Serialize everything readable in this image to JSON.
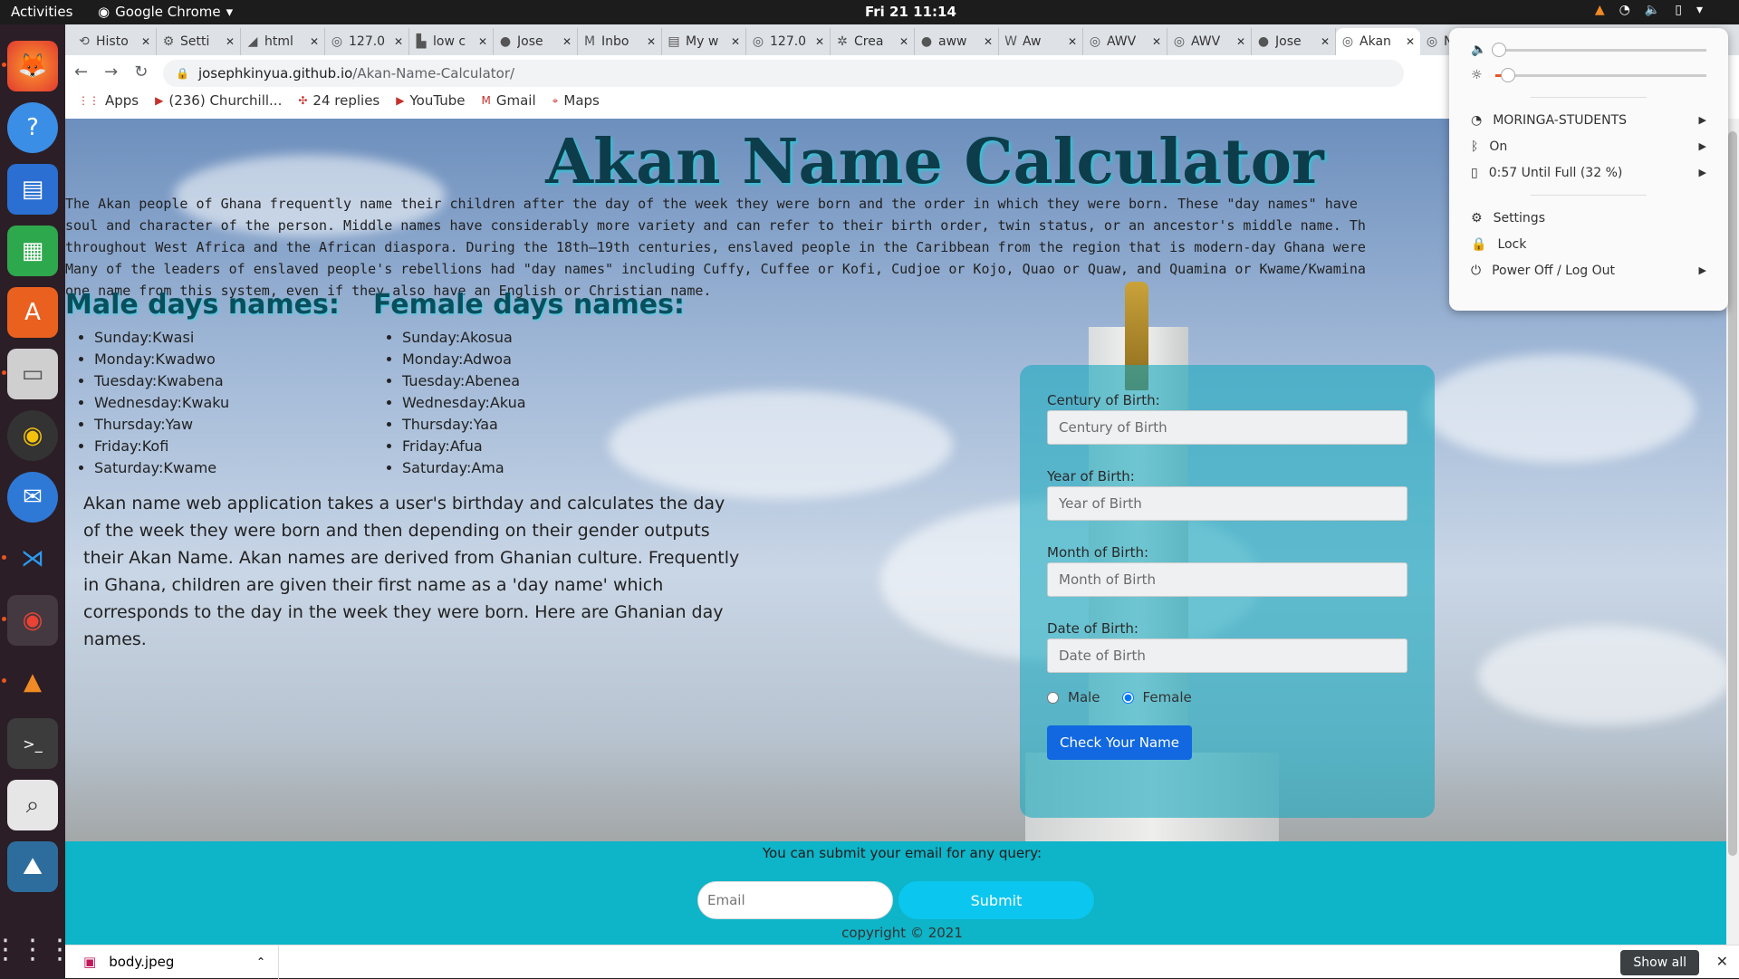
{
  "topbar": {
    "activities": "Activities",
    "app_name": "Google Chrome",
    "clock": "Fri 21  11:14"
  },
  "tabs": [
    {
      "title": "Histo",
      "icon": "history-icon"
    },
    {
      "title": "Setti",
      "icon": "gear-icon"
    },
    {
      "title": "html",
      "icon": "html-icon"
    },
    {
      "title": "127.0",
      "icon": "globe-icon"
    },
    {
      "title": "low c",
      "icon": "stackoverflow-icon"
    },
    {
      "title": "Jose",
      "icon": "github-icon"
    },
    {
      "title": "Inbo",
      "icon": "gmail-icon"
    },
    {
      "title": "My w",
      "icon": "docs-icon"
    },
    {
      "title": "127.0",
      "icon": "globe-icon"
    },
    {
      "title": "Crea",
      "icon": "create-icon"
    },
    {
      "title": "aww",
      "icon": "github-icon"
    },
    {
      "title": "Aw",
      "icon": "wikipedia-icon"
    },
    {
      "title": "AWV",
      "icon": "globe-icon"
    },
    {
      "title": "AWV",
      "icon": "globe-icon"
    },
    {
      "title": "Jose",
      "icon": "github-icon"
    },
    {
      "title": "Akan",
      "icon": "globe-icon"
    },
    {
      "title": "New",
      "icon": "globe-icon"
    }
  ],
  "url": {
    "domain": "josephkinyua.github.io",
    "path": "/Akan-Name-Calculator/"
  },
  "bookmarks": [
    {
      "label": "Apps",
      "icon": "apps-grid-icon"
    },
    {
      "label": "(236) Churchill...",
      "icon": "youtube-icon"
    },
    {
      "label": "24 replies",
      "icon": "slack-icon"
    },
    {
      "label": "YouTube",
      "icon": "youtube-icon"
    },
    {
      "label": "Gmail",
      "icon": "gmail-icon"
    },
    {
      "label": "Maps",
      "icon": "maps-icon"
    }
  ],
  "page": {
    "title": "Akan Name Calculator",
    "intro": "The Akan people of Ghana frequently name their children after the day of the week they were born and the order in which they were born. These \"day names\" have\nsoul and character of the person. Middle names have considerably more variety and can refer to their birth order, twin status, or an ancestor's middle name. Th\nthroughout West Africa and the African diaspora. During the 18th–19th centuries, enslaved people in the Caribbean from the region that is modern-day Ghana were\nMany of the leaders of enslaved people's rebellions had \"day names\" including Cuffy, Cuffee or Kofi, Cudjoe or Kojo, Quao or Quaw, and Quamina or Kwame/Kwamina\none name from this system, even if they also have an English or Christian name.",
    "male_heading": "Male days names:",
    "male_names": [
      "Sunday:Kwasi",
      "Monday:Kwadwo",
      "Tuesday:Kwabena",
      "Wednesday:Kwaku",
      "Thursday:Yaw",
      "Friday:Kofi",
      "Saturday:Kwame"
    ],
    "female_heading": "Female days names:",
    "female_names": [
      "Sunday:Akosua",
      "Monday:Adwoa",
      "Tuesday:Abenea",
      "Wednesday:Akua",
      "Thursday:Yaa",
      "Friday:Afua",
      "Saturday:Ama"
    ],
    "description": "Akan name web application takes a user's birthday and calculates the day of the week they were born and then depending on their gender outputs their Akan Name. Akan names are derived from Ghanian culture. Frequently in Ghana, children are given their first name as a 'day name' which corresponds to the day in the week they were born. Here are Ghanian day names."
  },
  "form": {
    "century_label": "Century of Birth:",
    "century_placeholder": "Century of Birth",
    "year_label": "Year of Birth:",
    "year_placeholder": "Year of Birth",
    "month_label": "Month of Birth:",
    "month_placeholder": "Month of Birth",
    "date_label": "Date of Birth:",
    "date_placeholder": "Date of Birth",
    "male_label": "Male",
    "female_label": "Female",
    "selected_gender": "Female",
    "button": "Check Your Name"
  },
  "footer": {
    "query_text": "You can submit your email for any query:",
    "email_placeholder": "Email",
    "submit_label": "Submit",
    "copyright": "copyright © 2021"
  },
  "downloads": {
    "file": "body.jpeg",
    "show_all": "Show all"
  },
  "system_menu": {
    "volume_level": 0.0,
    "brightness_level": 0.06,
    "wifi": "MORINGA-STUDENTS",
    "bluetooth": "On",
    "battery": "0:57 Until Full (32 %)",
    "settings": "Settings",
    "lock": "Lock",
    "power": "Power Off / Log Out"
  },
  "colors": {
    "title_shadow": "#2fc7d8",
    "form_bg": "#17a8be",
    "footer_bg": "#0eb4c7",
    "button": "#1168e0",
    "submit": "#0bc6ef"
  }
}
